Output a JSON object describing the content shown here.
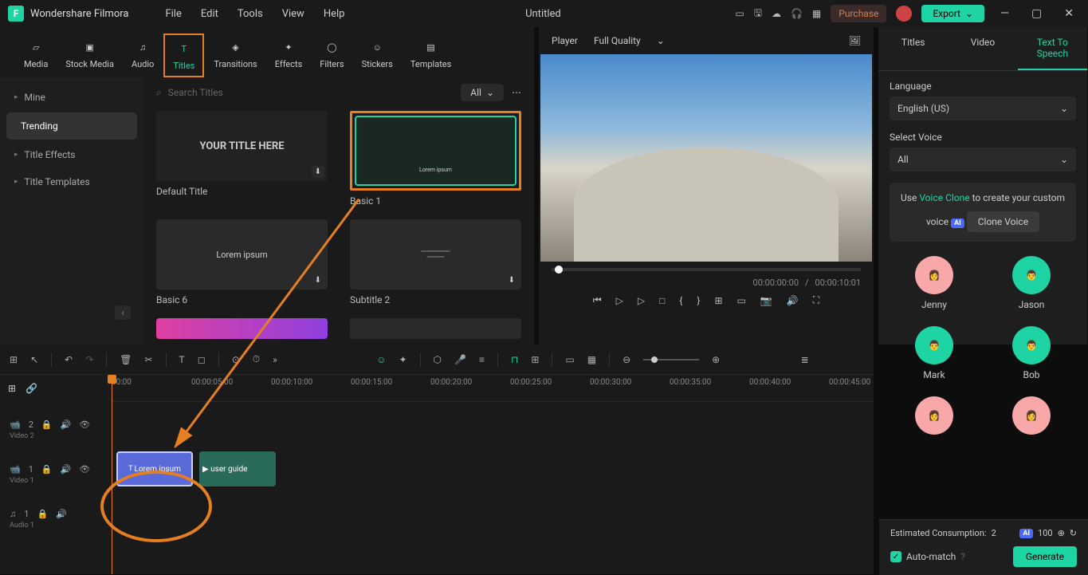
{
  "app": {
    "name": "Wondershare Filmora",
    "document": "Untitled"
  },
  "menubar": [
    "File",
    "Edit",
    "Tools",
    "View",
    "Help"
  ],
  "header": {
    "purchase": "Purchase",
    "export": "Export"
  },
  "tabs": [
    {
      "id": "media",
      "label": "Media"
    },
    {
      "id": "stock",
      "label": "Stock Media"
    },
    {
      "id": "audio",
      "label": "Audio"
    },
    {
      "id": "titles",
      "label": "Titles",
      "active": true
    },
    {
      "id": "transitions",
      "label": "Transitions"
    },
    {
      "id": "effects",
      "label": "Effects"
    },
    {
      "id": "filters",
      "label": "Filters"
    },
    {
      "id": "stickers",
      "label": "Stickers"
    },
    {
      "id": "templates",
      "label": "Templates"
    }
  ],
  "sidebar": [
    "Mine",
    "Trending",
    "Title Effects",
    "Title Templates"
  ],
  "search": {
    "placeholder": "Search Titles",
    "filter": "All"
  },
  "titles_gallery": [
    {
      "label": "Default Title",
      "text": "YOUR TITLE HERE",
      "dl": true
    },
    {
      "label": "Basic 1",
      "text": "Lorem ipsum",
      "highlight": true
    },
    {
      "label": "Basic 6",
      "text": "Lorem ipsum",
      "dl": true
    },
    {
      "label": "Subtitle 2",
      "text": "",
      "dl": true
    }
  ],
  "preview": {
    "label": "Player",
    "quality": "Full Quality",
    "time_current": "00:00:00:00",
    "time_total": "00:00:10:01"
  },
  "right_panel": {
    "tabs": [
      "Titles",
      "Video",
      "Text To Speech"
    ],
    "language_label": "Language",
    "language_value": "English (US)",
    "voice_label": "Select Voice",
    "voice_filter": "All",
    "clone_prefix": "Use ",
    "clone_link": "Voice Clone",
    "clone_suffix": " to create your custom voice",
    "clone_btn": "Clone Voice",
    "voices": [
      "Jenny",
      "Jason",
      "Mark",
      "Bob"
    ],
    "est_label": "Estimated Consumption:",
    "est_value": "2",
    "credits": "100",
    "automatch": "Auto-match",
    "generate": "Generate"
  },
  "timeline": {
    "ticks": [
      "00:00",
      "00:00:05:00",
      "00:00:10:00",
      "00:00:15:00",
      "00:00:20:00",
      "00:00:25:00",
      "00:00:30:00",
      "00:00:35:00",
      "00:00:40:00",
      "00:00:45:00"
    ],
    "tracks": [
      {
        "icon": "cam",
        "num": "2",
        "label": "Video 2"
      },
      {
        "icon": "cam",
        "num": "1",
        "label": "Video 1"
      },
      {
        "icon": "note",
        "num": "1",
        "label": "Audio 1"
      }
    ],
    "clip_title": "Lorem ipsum",
    "clip_video": "user guide"
  }
}
